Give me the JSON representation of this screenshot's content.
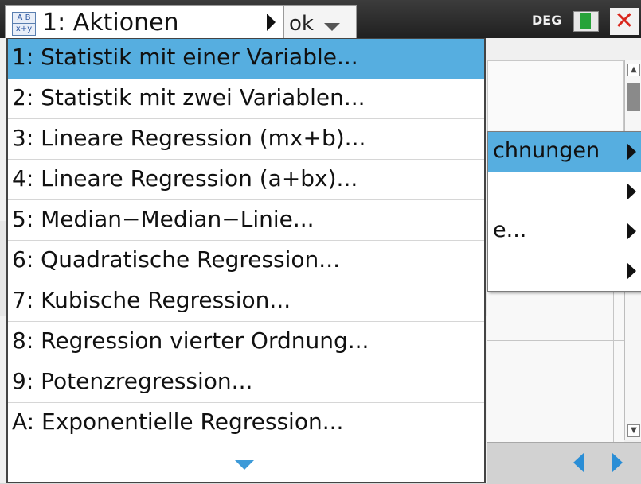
{
  "header": {
    "app_tab_title": "1: Aktionen",
    "doc_tab_label": "ok",
    "angle_mode": "DEG"
  },
  "menu": {
    "items": [
      {
        "label": "1: Statistik mit einer Variable..."
      },
      {
        "label": "2: Statistik mit zwei Variablen..."
      },
      {
        "label": "3: Lineare Regression (mx+b)..."
      },
      {
        "label": "4: Lineare Regression (a+bx)..."
      },
      {
        "label": "5: Median−Median−Linie..."
      },
      {
        "label": "6: Quadratische Regression..."
      },
      {
        "label": "7: Kubische Regression..."
      },
      {
        "label": "8: Regression vierter Ordnung..."
      },
      {
        "label": "9: Potenzregression..."
      },
      {
        "label": "A: Exponentielle Regression..."
      }
    ],
    "selected_index": 0,
    "more_indicator_icon": "chevron-down-icon"
  },
  "submenu": {
    "items": [
      {
        "label": "chnungen",
        "has_arrow": true
      },
      {
        "label": "",
        "has_arrow": true
      },
      {
        "label": "e...",
        "has_arrow": true
      },
      {
        "label": "",
        "has_arrow": true
      }
    ]
  },
  "icons": {
    "app": "list-spreadsheet-icon",
    "battery": "battery-icon",
    "close": "close-icon",
    "nav_back": "arrow-left-icon",
    "nav_forward": "arrow-right-icon"
  },
  "colors": {
    "highlight": "#56aee0",
    "accent": "#2a8ed6",
    "close": "#d9261c",
    "battery": "#27a33a"
  }
}
